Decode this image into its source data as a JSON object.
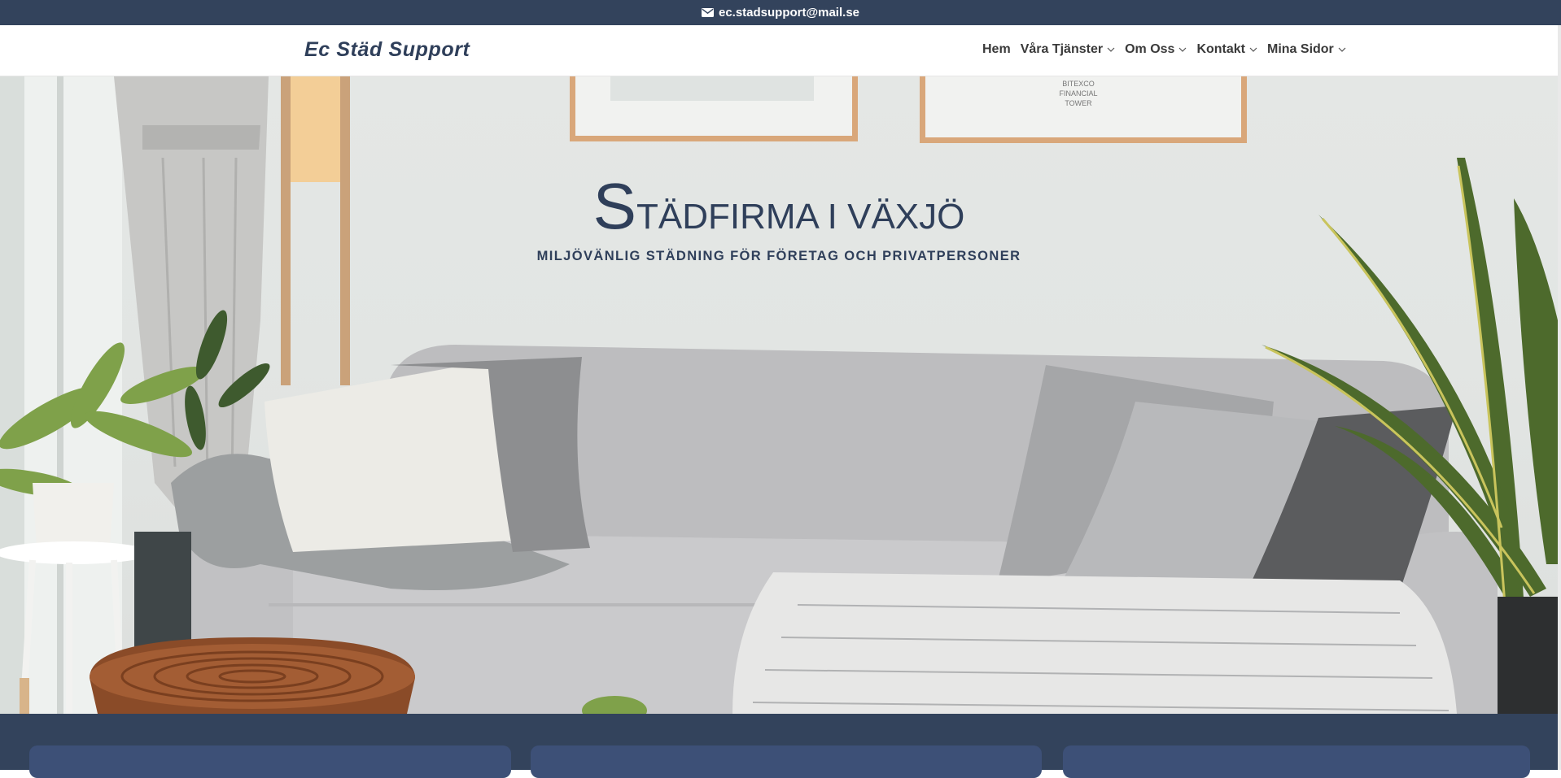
{
  "topbar": {
    "email": "ec.stadsupport@mail.se",
    "icon": "envelope-icon"
  },
  "header": {
    "logo": "Ec Städ Support",
    "nav": [
      {
        "label": "Hem",
        "has_dropdown": false
      },
      {
        "label": "Våra Tjänster",
        "has_dropdown": true
      },
      {
        "label": "Om Oss",
        "has_dropdown": true
      },
      {
        "label": "Kontakt",
        "has_dropdown": true
      },
      {
        "label": "Mina Sidor",
        "has_dropdown": true
      }
    ]
  },
  "hero": {
    "title_first": "S",
    "title_rest": "TÄDFIRMA I VÄXJÖ",
    "subtitle": "MILJÖVÄNLIG STÄDNING FÖR FÖRETAG OCH PRIVATPERSONER",
    "poster_text": [
      "BITEXCO",
      "FINANCIAL",
      "TOWER"
    ]
  },
  "colors": {
    "navy": "#33435c",
    "title": "#2f3f5a",
    "card": "#3d5077"
  }
}
